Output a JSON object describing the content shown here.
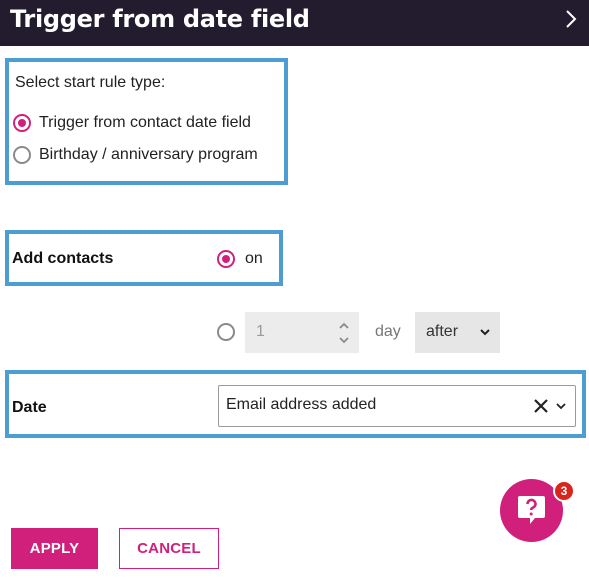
{
  "header": {
    "title": "Trigger from date field",
    "chevron_icon": "chevron-right-icon"
  },
  "rule_type": {
    "prompt": "Select start rule type:",
    "options": [
      {
        "label": "Trigger from contact date field",
        "selected": true
      },
      {
        "label": "Birthday / anniversary program",
        "selected": false
      }
    ]
  },
  "add_contacts": {
    "label": "Add contacts",
    "option_label": "on",
    "selected": true
  },
  "offset": {
    "selected": false,
    "number_value": "1",
    "unit_label": "day",
    "direction_value": "after"
  },
  "date": {
    "label": "Date",
    "selected_value": "Email address added"
  },
  "help": {
    "icon": "question-chat-icon",
    "badge_count": "3"
  },
  "actions": {
    "apply_label": "APPLY",
    "cancel_label": "CANCEL"
  },
  "colors": {
    "header_bg": "#231c2e",
    "accent": "#d0207c",
    "highlight_border": "#4d9cd2",
    "badge": "#d8261d"
  }
}
